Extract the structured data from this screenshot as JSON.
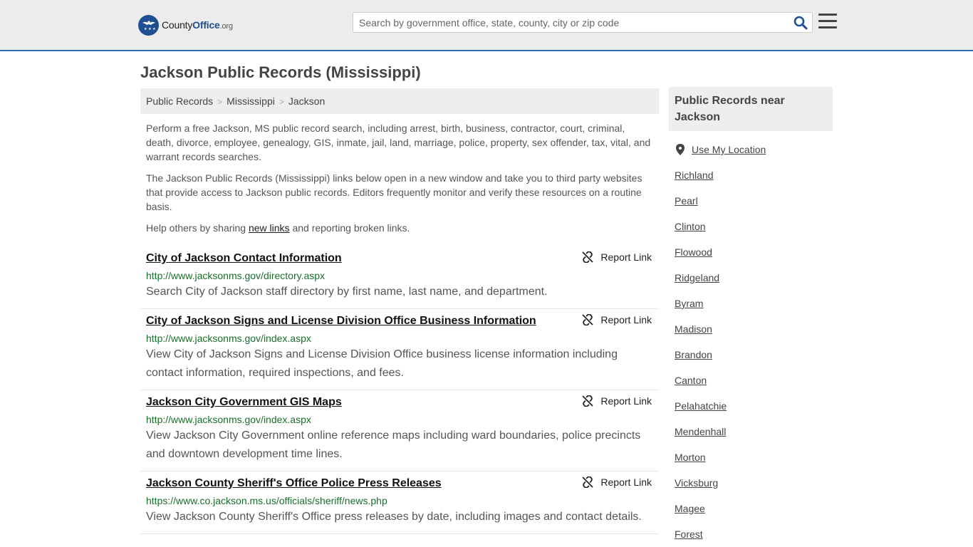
{
  "header": {
    "logo": {
      "county": "County",
      "office": "Office",
      "tld": ".org"
    },
    "search_placeholder": "Search by government office, state, county, city or zip code",
    "search_icon": "search-icon",
    "menu_icon": "hamburger-menu-icon"
  },
  "page": {
    "title": "Jackson Public Records (Mississippi)",
    "breadcrumb": [
      "Public Records",
      "Mississippi",
      "Jackson"
    ],
    "intro1": "Perform a free Jackson, MS public record search, including arrest, birth, business, contractor, court, criminal, death, divorce, employee, genealogy, GIS, inmate, jail, land, marriage, police, property, sex offender, tax, vital, and warrant records searches.",
    "intro2": "The Jackson Public Records (Mississippi) links below open in a new window and take you to third party websites that provide access to Jackson public records. Editors frequently monitor and verify these resources on a routine basis.",
    "help_prefix": "Help others by sharing ",
    "help_link": "new links",
    "help_suffix": " and reporting broken links."
  },
  "report_label": "Report Link",
  "records": [
    {
      "title": "City of Jackson Contact Information",
      "url": "http://www.jacksonms.gov/directory.aspx",
      "desc": "Search City of Jackson staff directory by first name, last name, and department."
    },
    {
      "title": "City of Jackson Signs and License Division Office Business Information",
      "url": "http://www.jacksonms.gov/index.aspx",
      "desc": "View City of Jackson Signs and License Division Office business license information including contact information, required inspections, and fees."
    },
    {
      "title": "Jackson City Government GIS Maps",
      "url": "http://www.jacksonms.gov/index.aspx",
      "desc": "View Jackson City Government online reference maps including ward boundaries, police precincts and downtown development time lines."
    },
    {
      "title": "Jackson County Sheriff's Office Police Press Releases",
      "url": "https://www.co.jackson.ms.us/officials/sheriff/news.php",
      "desc": "View Jackson County Sheriff's Office press releases by date, including images and contact details."
    }
  ],
  "sidebar": {
    "heading": "Public Records near Jackson",
    "use_location": "Use My Location",
    "cities": [
      "Richland",
      "Pearl",
      "Clinton",
      "Flowood",
      "Ridgeland",
      "Byram",
      "Madison",
      "Brandon",
      "Canton",
      "Pelahatchie",
      "Mendenhall",
      "Morton",
      "Vicksburg",
      "Magee",
      "Forest"
    ]
  },
  "colors": {
    "brand": "#1d4f91",
    "header_border": "#2a6ab2",
    "url_green": "#1a6e2a"
  }
}
